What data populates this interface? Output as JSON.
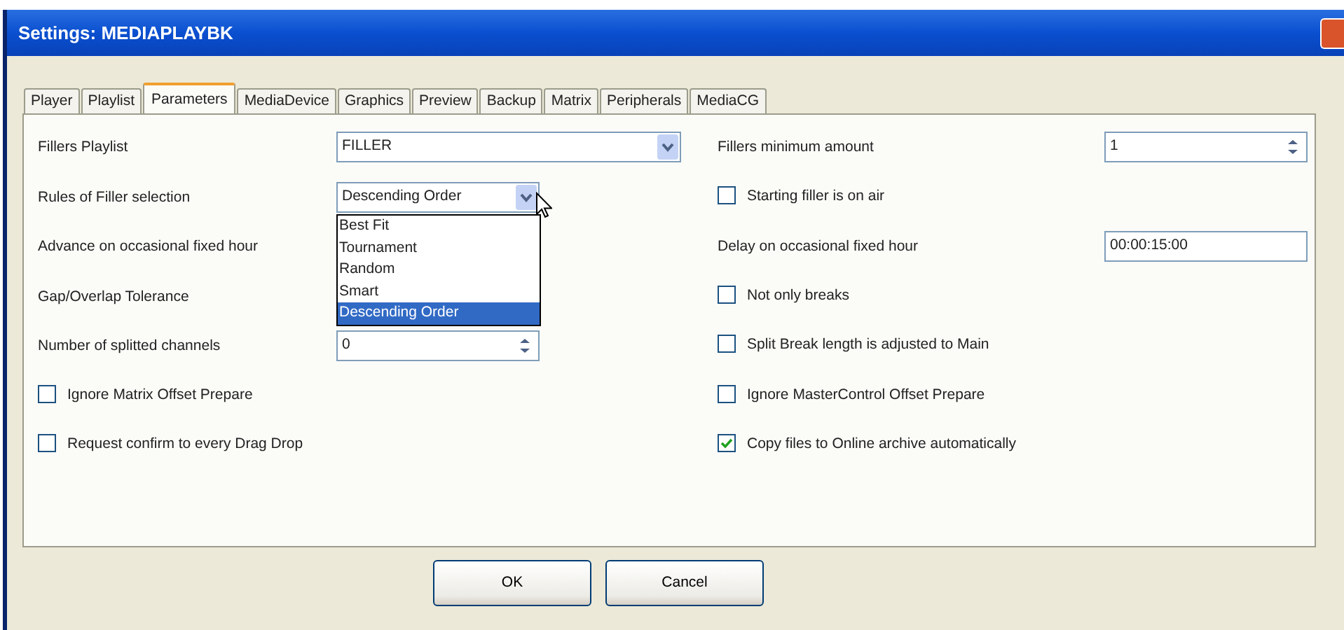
{
  "window": {
    "title": "Settings: MEDIAPLAYBK"
  },
  "tabs": [
    {
      "label": "Player",
      "selected": false
    },
    {
      "label": "Playlist",
      "selected": false
    },
    {
      "label": "Parameters",
      "selected": true
    },
    {
      "label": "MediaDevice",
      "selected": false
    },
    {
      "label": "Graphics",
      "selected": false
    },
    {
      "label": "Preview",
      "selected": false
    },
    {
      "label": "Backup",
      "selected": false
    },
    {
      "label": "Matrix",
      "selected": false
    },
    {
      "label": "Peripherals",
      "selected": false
    },
    {
      "label": "MediaCG",
      "selected": false
    }
  ],
  "left_rows": [
    {
      "kind": "combo",
      "label": "Fillers Playlist",
      "value": "FILLER",
      "wide": true
    },
    {
      "kind": "combo",
      "label": "Rules of Filler selection",
      "value": "Descending Order",
      "expanded": true,
      "options": [
        {
          "label": "Best Fit",
          "selected": false
        },
        {
          "label": "Tournament",
          "selected": false
        },
        {
          "label": "Random",
          "selected": false
        },
        {
          "label": "Smart",
          "selected": false
        },
        {
          "label": "Descending Order",
          "selected": true
        }
      ]
    },
    {
      "kind": "label",
      "label": "Advance on occasional fixed hour"
    },
    {
      "kind": "label",
      "label": "Gap/Overlap Tolerance"
    },
    {
      "kind": "spin",
      "label": "Number of splitted channels",
      "value": "0"
    },
    {
      "kind": "checkbox",
      "label": "Ignore Matrix Offset Prepare",
      "checked": false
    },
    {
      "kind": "checkbox",
      "label": "Request confirm to every Drag Drop",
      "checked": false
    }
  ],
  "right_rows": [
    {
      "kind": "spin",
      "label": "Fillers minimum amount",
      "value": "1"
    },
    {
      "kind": "checkbox",
      "label": "Starting filler is on air",
      "checked": false
    },
    {
      "kind": "text",
      "label": "Delay on occasional fixed hour",
      "value": "00:00:15:00"
    },
    {
      "kind": "checkbox",
      "label": "Not only breaks",
      "checked": false
    },
    {
      "kind": "checkbox",
      "label": "Split Break length is adjusted to Main",
      "checked": false
    },
    {
      "kind": "checkbox",
      "label": "Ignore MasterControl Offset Prepare",
      "checked": false
    },
    {
      "kind": "checkbox",
      "label": "Copy files to Online archive automatically",
      "checked": true
    }
  ],
  "buttons": [
    "OK",
    "Cancel"
  ]
}
